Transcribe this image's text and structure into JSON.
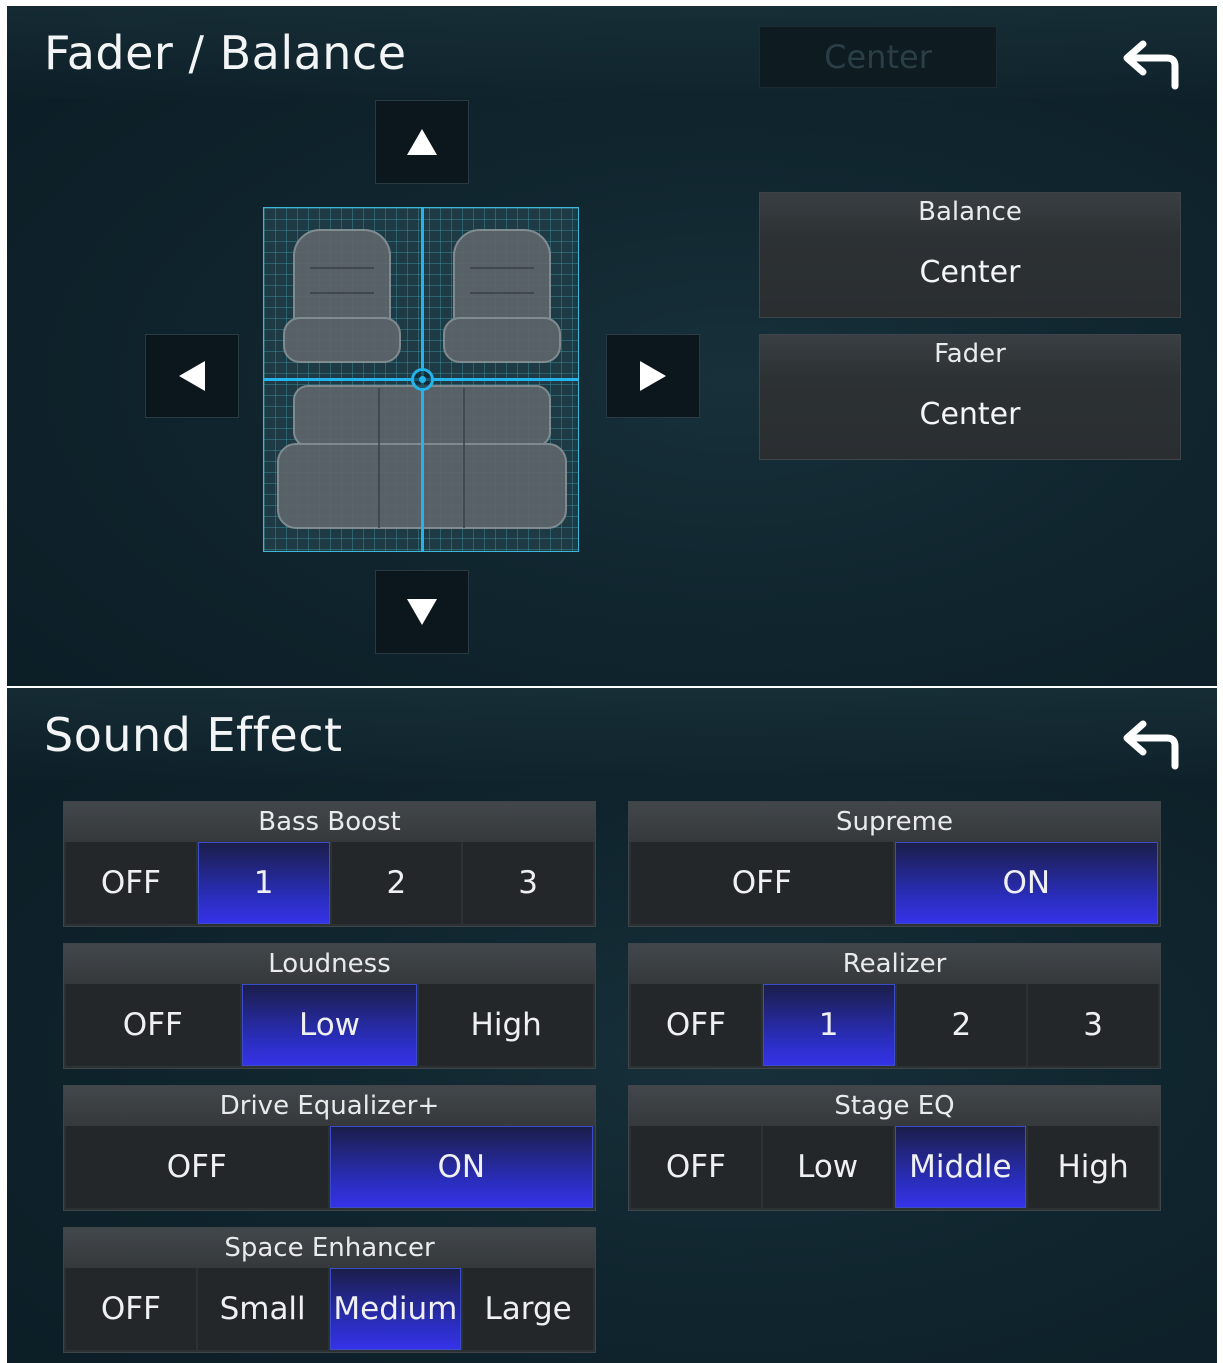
{
  "fader_balance": {
    "title": "Fader / Balance",
    "center_button": "Center",
    "back_icon": "return-arrow-icon",
    "balance": {
      "label": "Balance",
      "value": "Center"
    },
    "fader": {
      "label": "Fader",
      "value": "Center"
    },
    "arrows": [
      "up-arrow-icon",
      "down-arrow-icon",
      "left-arrow-icon",
      "right-arrow-icon"
    ],
    "colors": {
      "crosshair": "#22b4ea",
      "grid": "#3db8d8"
    }
  },
  "sound_effect": {
    "title": "Sound Effect",
    "back_icon": "return-arrow-icon",
    "selected_color": "#3532e8",
    "groups": {
      "bass_boost": {
        "label": "Bass Boost",
        "options": [
          "OFF",
          "1",
          "2",
          "3"
        ],
        "selected": "1"
      },
      "loudness": {
        "label": "Loudness",
        "options": [
          "OFF",
          "Low",
          "High"
        ],
        "selected": "Low"
      },
      "drive_eq": {
        "label": "Drive Equalizer+",
        "options": [
          "OFF",
          "ON"
        ],
        "selected": "ON"
      },
      "space_enhancer": {
        "label": "Space Enhancer",
        "options": [
          "OFF",
          "Small",
          "Medium",
          "Large"
        ],
        "selected": "Medium"
      },
      "supreme": {
        "label": "Supreme",
        "options": [
          "OFF",
          "ON"
        ],
        "selected": "ON"
      },
      "realizer": {
        "label": "Realizer",
        "options": [
          "OFF",
          "1",
          "2",
          "3"
        ],
        "selected": "1"
      },
      "stage_eq": {
        "label": "Stage EQ",
        "options": [
          "OFF",
          "Low",
          "Middle",
          "High"
        ],
        "selected": "Middle"
      }
    }
  }
}
